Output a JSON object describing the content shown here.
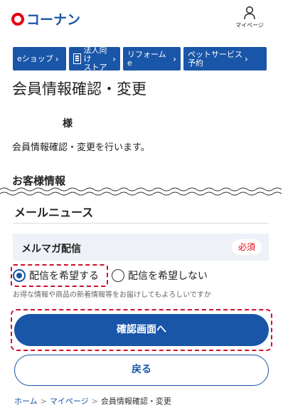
{
  "header": {
    "logo_text": "コーナン",
    "mypage_label": "マイページ"
  },
  "nav": {
    "eshop": "eショップ",
    "houjin_line1": "法人向け",
    "houjin_line2": "ストア",
    "reform": "リフォームe",
    "pet_line1": "ペットサービス",
    "pet_line2": "予約",
    "chevron": "›"
  },
  "page_title": "会員情報確認・変更",
  "member_suffix": "様",
  "description": "会員情報確認・変更を行います。",
  "section_customer": "お客様情報",
  "section_mailnews": "メールニュース",
  "melmaga": {
    "label": "メルマガ配信",
    "required_badge": "必須"
  },
  "radios": {
    "yes_label": "配信を希望する",
    "no_label": "配信を希望しない",
    "selected": "yes"
  },
  "hint": "お得な情報や商品の新着情報等をお届けしてもよろしいですか",
  "buttons": {
    "confirm": "確認画面へ",
    "back": "戻る"
  },
  "breadcrumb": {
    "home": "ホーム",
    "mypage": "マイページ",
    "current": "会員情報確認・変更",
    "sep": ">"
  },
  "colors": {
    "brand_blue": "#1a56a8",
    "brand_red": "#e60012",
    "highlight_dash": "#d0102b"
  }
}
